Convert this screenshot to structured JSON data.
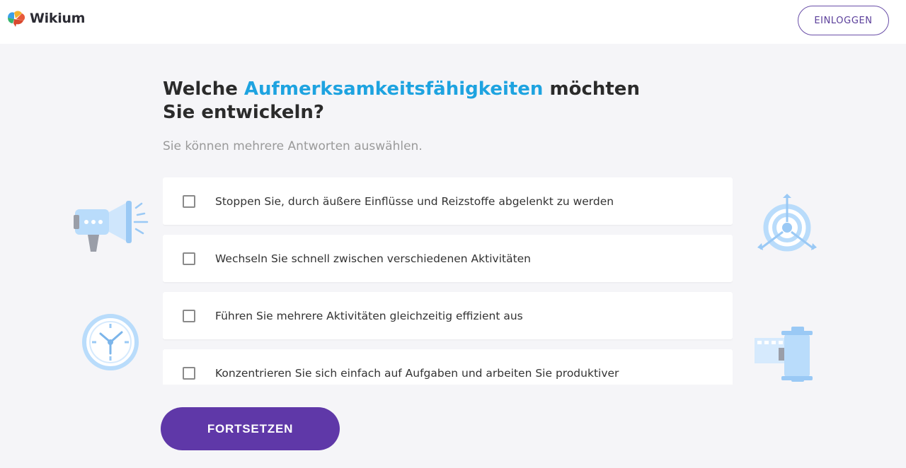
{
  "header": {
    "logo_text": "Wikium",
    "login_label": "EINLOGGEN"
  },
  "question": {
    "title_before": "Welche ",
    "title_accent": "Aufmerksamkeitsfähigkeiten",
    "title_after": " möchten Sie entwickeln?",
    "subtitle": "Sie können mehrere Antworten auswählen."
  },
  "options": [
    {
      "label": "Stoppen Sie, durch äußere Einflüsse und Reizstoffe abgelenkt zu werden",
      "checked": false
    },
    {
      "label": "Wechseln Sie schnell zwischen verschiedenen Aktivitäten",
      "checked": false
    },
    {
      "label": "Führen Sie mehrere Aktivitäten gleichzeitig effizient aus",
      "checked": false
    },
    {
      "label": "Konzentrieren Sie sich einfach auf Aufgaben und arbeiten Sie produktiver",
      "checked": false
    }
  ],
  "footer": {
    "continue_label": "FORTSETZEN"
  },
  "icons": {
    "logo": "brain-logo-icon",
    "left_top": "megaphone-icon",
    "left_bottom": "clock-icon",
    "right_top": "target-icon",
    "right_bottom": "film-roll-icon"
  },
  "colors": {
    "accent": "#1ea3e0",
    "primary": "#5f38a8",
    "illustration": "#b9dcfb"
  }
}
